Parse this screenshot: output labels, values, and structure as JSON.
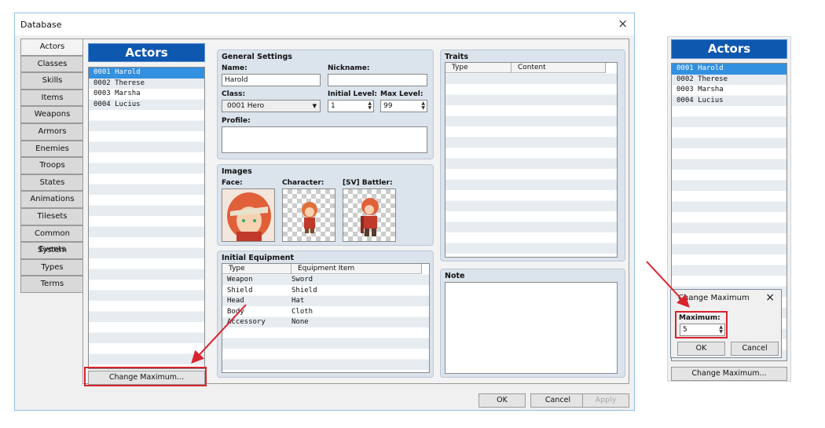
{
  "window": {
    "title": "Database",
    "close": "×"
  },
  "tabs": [
    "Actors",
    "Classes",
    "Skills",
    "Items",
    "Weapons",
    "Armors",
    "Enemies",
    "Troops",
    "States",
    "Animations",
    "Tilesets",
    "Common Events",
    "System",
    "Types",
    "Terms"
  ],
  "actors": {
    "header": "Actors",
    "items": [
      "0001 Harold",
      "0002 Therese",
      "0003 Marsha",
      "0004 Lucius"
    ],
    "change_max": "Change Maximum..."
  },
  "general": {
    "title": "General Settings",
    "name_label": "Name:",
    "name_value": "Harold",
    "nickname_label": "Nickname:",
    "nickname_value": "",
    "class_label": "Class:",
    "class_value": "0001 Hero",
    "init_level_label": "Initial Level:",
    "init_level_value": "1",
    "max_level_label": "Max Level:",
    "max_level_value": "99",
    "profile_label": "Profile:"
  },
  "images": {
    "title": "Images",
    "face_label": "Face:",
    "character_label": "Character:",
    "battler_label": "[SV] Battler:"
  },
  "equipment": {
    "title": "Initial Equipment",
    "col_type": "Type",
    "col_item": "Equipment Item",
    "rows": [
      [
        "Weapon",
        "Sword"
      ],
      [
        "Shield",
        "Shield"
      ],
      [
        "Head",
        "Hat"
      ],
      [
        "Body",
        "Cloth"
      ],
      [
        "Accessory",
        "None"
      ]
    ]
  },
  "traits": {
    "title": "Traits",
    "col_type": "Type",
    "col_content": "Content"
  },
  "note": {
    "title": "Note"
  },
  "buttons": {
    "ok": "OK",
    "cancel": "Cancel",
    "apply": "Apply"
  },
  "dialog": {
    "title": "Change Maximum",
    "close": "×",
    "max_label": "Maximum:",
    "max_value": "5",
    "ok": "OK",
    "cancel": "Cancel"
  },
  "colors": {
    "header_blue": "#0f58b0",
    "selection_blue": "#3390e0",
    "highlight_red": "#d9232e"
  }
}
